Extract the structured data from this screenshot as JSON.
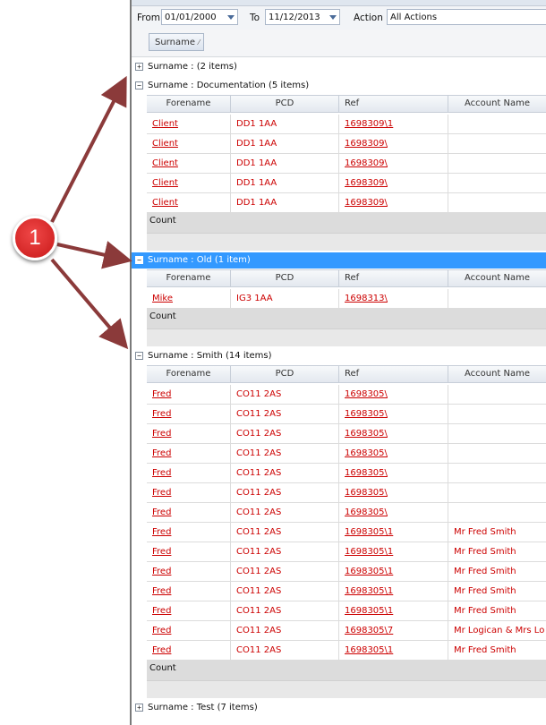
{
  "toolbar": {
    "from_label": "From",
    "from_value": "01/01/2000",
    "to_label": "To",
    "to_value": "11/12/2013",
    "action_label": "Action",
    "action_value": "All Actions"
  },
  "group_by_chip": "Surname",
  "columns": [
    "Forename",
    "PCD",
    "Ref",
    "Account Name"
  ],
  "groups": [
    {
      "label": "Surname :  (2 items)",
      "expanded": false
    },
    {
      "label": "Surname : Documentation (5 items)",
      "expanded": true
    },
    {
      "label": "Surname : Old (1 item)",
      "expanded": true,
      "selected": true
    },
    {
      "label": "Surname : Smith (14 items)",
      "expanded": true
    },
    {
      "label": "Surname : Test (7 items)",
      "expanded": false
    }
  ],
  "count_label": "Count",
  "documentation_rows": [
    [
      "Client",
      "DD1 1AA",
      "1698309\\1",
      ""
    ],
    [
      "Client",
      "DD1 1AA",
      "1698309\\",
      ""
    ],
    [
      "Client",
      "DD1 1AA",
      "1698309\\",
      ""
    ],
    [
      "Client",
      "DD1 1AA",
      "1698309\\",
      ""
    ],
    [
      "Client",
      "DD1 1AA",
      "1698309\\",
      ""
    ]
  ],
  "old_rows": [
    [
      "Mike",
      "IG3 1AA",
      "1698313\\",
      ""
    ]
  ],
  "smith_rows": [
    [
      "Fred",
      "CO11 2AS",
      "1698305\\",
      ""
    ],
    [
      "Fred",
      "CO11 2AS",
      "1698305\\",
      ""
    ],
    [
      "Fred",
      "CO11 2AS",
      "1698305\\",
      ""
    ],
    [
      "Fred",
      "CO11 2AS",
      "1698305\\",
      ""
    ],
    [
      "Fred",
      "CO11 2AS",
      "1698305\\",
      ""
    ],
    [
      "Fred",
      "CO11 2AS",
      "1698305\\",
      ""
    ],
    [
      "Fred",
      "CO11 2AS",
      "1698305\\",
      ""
    ],
    [
      "Fred",
      "CO11 2AS",
      "1698305\\1",
      "Mr Fred Smith"
    ],
    [
      "Fred",
      "CO11 2AS",
      "1698305\\1",
      "Mr Fred Smith"
    ],
    [
      "Fred",
      "CO11 2AS",
      "1698305\\1",
      "Mr Fred Smith"
    ],
    [
      "Fred",
      "CO11 2AS",
      "1698305\\1",
      "Mr Fred Smith"
    ],
    [
      "Fred",
      "CO11 2AS",
      "1698305\\1",
      "Mr Fred Smith"
    ],
    [
      "Fred",
      "CO11 2AS",
      "1698305\\7",
      "Mr Logican & Mrs Lo"
    ],
    [
      "Fred",
      "CO11 2AS",
      "1698305\\1",
      "Mr Fred Smith"
    ]
  ],
  "callout_number": "1",
  "colors": {
    "accent": "#3399ff",
    "link": "#cc0000",
    "callout": "#d42020",
    "arrow": "#8b3a3a"
  }
}
